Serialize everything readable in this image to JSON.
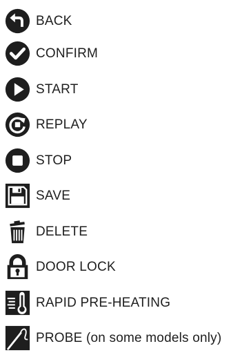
{
  "colors": {
    "icon": "#1e1e1e",
    "text": "#1e1e1e",
    "background": "#ffffff"
  },
  "items": [
    {
      "icon": "back-arrow-icon",
      "label": "BACK"
    },
    {
      "icon": "checkmark-icon",
      "label": "CONFIRM"
    },
    {
      "icon": "play-icon",
      "label": "START"
    },
    {
      "icon": "replay-icon",
      "label": "REPLAY"
    },
    {
      "icon": "stop-icon",
      "label": "STOP"
    },
    {
      "icon": "floppy-disk-icon",
      "label": "SAVE"
    },
    {
      "icon": "trash-can-icon",
      "label": "DELETE"
    },
    {
      "icon": "padlock-icon",
      "label": "DOOR LOCK"
    },
    {
      "icon": "rapid-preheat-icon",
      "label": "RAPID PRE-HEATING"
    },
    {
      "icon": "probe-icon",
      "label": "PROBE (on some models only)"
    }
  ]
}
